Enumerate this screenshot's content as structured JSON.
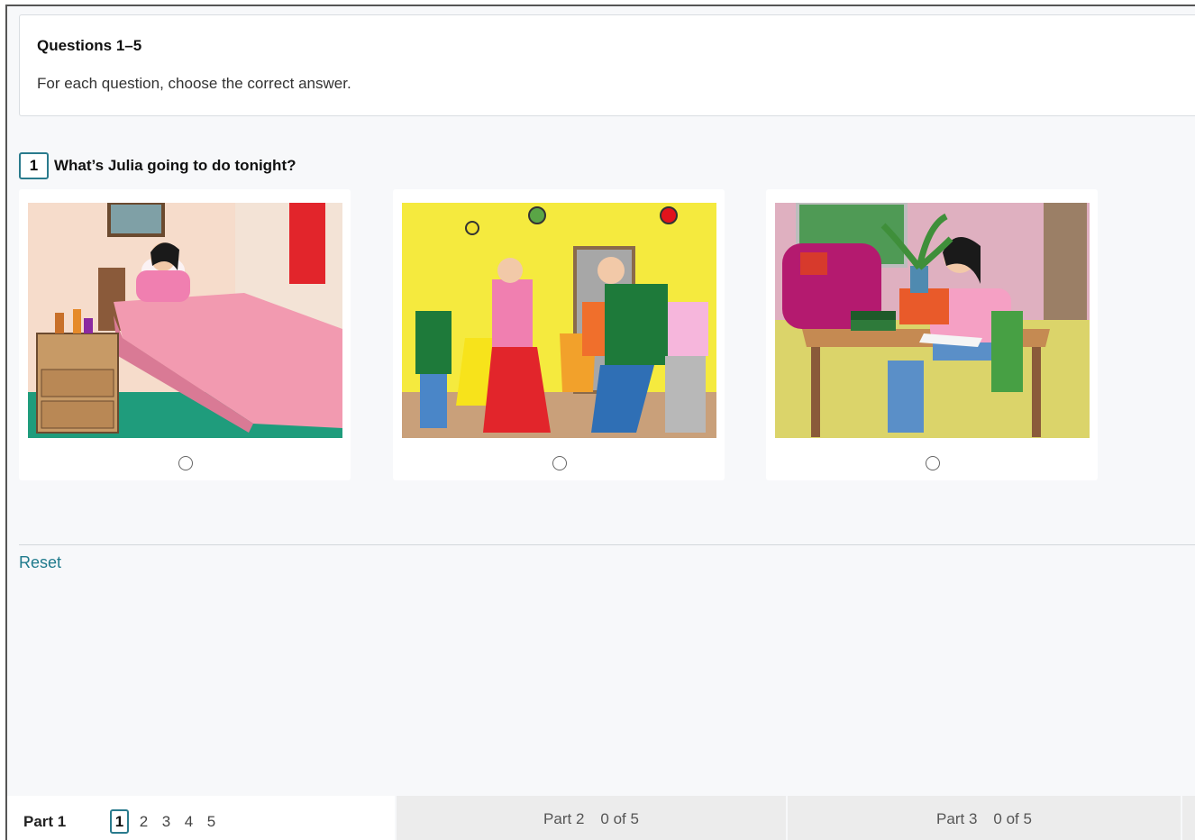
{
  "instructions": {
    "title": "Questions 1–5",
    "text": "For each question, choose the correct answer."
  },
  "question": {
    "number": "1",
    "text": "What’s Julia going to do tonight?"
  },
  "options": [
    {
      "id": "A",
      "icon": "sleeping-in-bed-illustration",
      "selected": false
    },
    {
      "id": "B",
      "icon": "party-dancing-illustration",
      "selected": false
    },
    {
      "id": "C",
      "icon": "reading-book-illustration",
      "selected": false
    }
  ],
  "reset_label": "Reset",
  "footer": {
    "current_part": "Part 1",
    "question_numbers": [
      "1",
      "2",
      "3",
      "4",
      "5"
    ],
    "active_question": "1",
    "parts": [
      {
        "label": "Part 2",
        "count": "0 of 5"
      },
      {
        "label": "Part 3",
        "count": "0 of 5"
      }
    ]
  },
  "colors": {
    "accent": "#2a7b8d",
    "link": "#1f7a8c",
    "background": "#f7f8fa",
    "tab_background": "#ececec"
  }
}
